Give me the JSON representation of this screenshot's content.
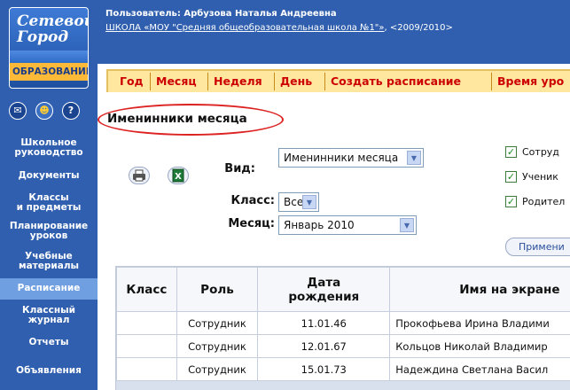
{
  "logo": {
    "line1": "Сетевой",
    "line2": "Город",
    "line3": "ОБРАЗОВАНИЕ"
  },
  "sidebar_icons": [
    {
      "name": "mail-icon",
      "glyph": "✉"
    },
    {
      "name": "users-icon",
      "glyph": "☻"
    },
    {
      "name": "help-icon",
      "glyph": "?"
    }
  ],
  "sidebar": {
    "items": [
      {
        "label": "Школьное руководство",
        "l1": "Школьное",
        "l2": "руководство"
      },
      {
        "label": "Документы",
        "l1": "Документы",
        "l2": ""
      },
      {
        "label": "Классы и предметы",
        "l1": "Классы",
        "l2": "и предметы"
      },
      {
        "label": "Планирование уроков",
        "l1": "Планирование",
        "l2": "уроков"
      },
      {
        "label": "Учебные материалы",
        "l1": "Учебные",
        "l2": "материалы"
      },
      {
        "label": "Расписание",
        "l1": "Расписание",
        "l2": ""
      },
      {
        "label": "Классный журнал",
        "l1": "Классный",
        "l2": "журнал"
      },
      {
        "label": "Отчеты",
        "l1": "Отчеты",
        "l2": ""
      },
      {
        "label": "Объявления",
        "l1": "Объявления",
        "l2": ""
      }
    ]
  },
  "header": {
    "user": "Пользователь: Арбузова Наталья Андреевна",
    "school_link": "ШКОЛА «МОУ \"Средняя общеобразовательная школа №1\"»",
    "year": ", <2009/2010>"
  },
  "tabs": [
    "Год",
    "Месяц",
    "Неделя",
    "День",
    "Создать расписание",
    "Время уро"
  ],
  "page_title": "Именинники месяца",
  "filters": {
    "view_label": "Вид:",
    "view_value": "Именинники месяца",
    "class_label": "Класс:",
    "class_value": "Все",
    "month_label": "Месяц:",
    "month_value": "Январь 2010"
  },
  "checkboxes": [
    {
      "label": "Сотруд",
      "checked": true
    },
    {
      "label": "Ученик",
      "checked": true
    },
    {
      "label": "Родител",
      "checked": true
    }
  ],
  "apply_button": "Примени",
  "table": {
    "headers": {
      "class": "Класс",
      "role": "Роль",
      "dob1": "Дата",
      "dob2": "рождения",
      "name": "Имя на экране"
    },
    "rows": [
      {
        "class": "",
        "role": "Сотрудник",
        "dob": "11.01.46",
        "name": "Прокофьева Ирина Владими"
      },
      {
        "class": "",
        "role": "Сотрудник",
        "dob": "12.01.67",
        "name": "Кольцов Николай Владимир"
      },
      {
        "class": "",
        "role": "Сотрудник",
        "dob": "15.01.73",
        "name": "Надеждина Светлана Васил"
      }
    ]
  },
  "colors": {
    "brand_blue": "#2f5fae",
    "tab_bg": "#ffe7a0",
    "tab_text": "#cc0000",
    "highlight_oval": "#dd2222"
  }
}
